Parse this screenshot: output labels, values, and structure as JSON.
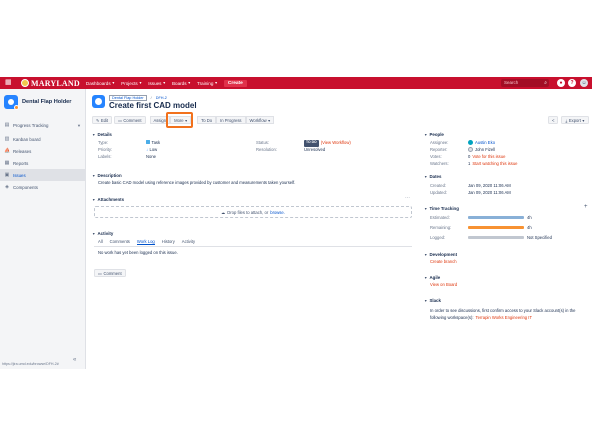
{
  "topnav": {
    "logo_text": "MARYLAND",
    "items": [
      {
        "label": "Dashboards"
      },
      {
        "label": "Projects"
      },
      {
        "label": "Issues"
      },
      {
        "label": "Boards"
      },
      {
        "label": "Training"
      }
    ],
    "create_label": "Create",
    "search_placeholder": "Search"
  },
  "sidebar": {
    "project_name": "Dental Flap Holder",
    "items": [
      {
        "label": "Progress Tracking",
        "icon": "board-icon"
      },
      {
        "label": "Kanban board",
        "icon": "kanban-icon"
      },
      {
        "label": "Releases",
        "icon": "ship-icon"
      },
      {
        "label": "Reports",
        "icon": "chart-icon"
      },
      {
        "label": "Issues",
        "icon": "issues-icon"
      },
      {
        "label": "Components",
        "icon": "puzzle-icon"
      }
    ],
    "status_url": "https://jira.umd.edu/browse/DFH-2#"
  },
  "issue": {
    "breadcrumb_project": "Dental Flap Holder",
    "breadcrumb_key": "DFH-2",
    "title": "Create first CAD model"
  },
  "toolbar": {
    "edit": "Edit",
    "comment": "Comment",
    "assign": "Assign",
    "more": "More",
    "todo": "To Do",
    "in_progress": "In Progress",
    "workflow": "Workflow",
    "export": "Export",
    "highlight_color": "#f2711c"
  },
  "details": {
    "heading": "Details",
    "type_label": "Type:",
    "type_value": "Task",
    "priority_label": "Priority:",
    "priority_value": "Low",
    "labels_label": "Labels:",
    "labels_value": "None",
    "status_label": "Status:",
    "status_value": "TO DO",
    "status_workflow": "(View Workflow)",
    "resolution_label": "Resolution:",
    "resolution_value": "Unresolved"
  },
  "description": {
    "heading": "Description",
    "text": "Create basic CAD model using reference images provided by customer and measurements taken yourself."
  },
  "attachments": {
    "heading": "Attachments",
    "drop_text": "Drop files to attach, or",
    "browse": "browse."
  },
  "activity": {
    "heading": "Activity",
    "tabs": [
      {
        "label": "All"
      },
      {
        "label": "Comments"
      },
      {
        "label": "Work Log"
      },
      {
        "label": "History"
      },
      {
        "label": "Activity"
      }
    ],
    "empty": "No work has yet been logged on this issue.",
    "comment_button": "Comment"
  },
  "people": {
    "heading": "People",
    "assignee_label": "Assignee:",
    "assignee": "Austin Eko",
    "reporter_label": "Reporter:",
    "reporter": "John Fizell",
    "votes_label": "Votes:",
    "votes": "0",
    "votes_link": "Vote for this issue",
    "watchers_label": "Watchers:",
    "watchers": "1",
    "watchers_link": "Start watching this issue"
  },
  "dates": {
    "heading": "Dates",
    "created_label": "Created:",
    "created": "Jan 09, 2020 11:06 AM",
    "updated_label": "Updated:",
    "updated": "Jan 09, 2020 11:06 AM"
  },
  "time_tracking": {
    "heading": "Time Tracking",
    "estimated_label": "Estimated:",
    "estimated": "4h",
    "remaining_label": "Remaining:",
    "remaining": "4h",
    "logged_label": "Logged:",
    "logged": "Not Specified",
    "estimated_color": "#89b0d7",
    "remaining_color": "#f79232",
    "logged_color": "#c1c7d0"
  },
  "development": {
    "heading": "Development",
    "link": "Create branch"
  },
  "agile": {
    "heading": "Agile",
    "link": "View on Board"
  },
  "slack": {
    "heading": "Slack",
    "text1": "In order to see discussions, first confirm access to your Slack account(s) in the",
    "text2": "following workspace(s):",
    "link": "Terrapin Works Engineering IT"
  }
}
